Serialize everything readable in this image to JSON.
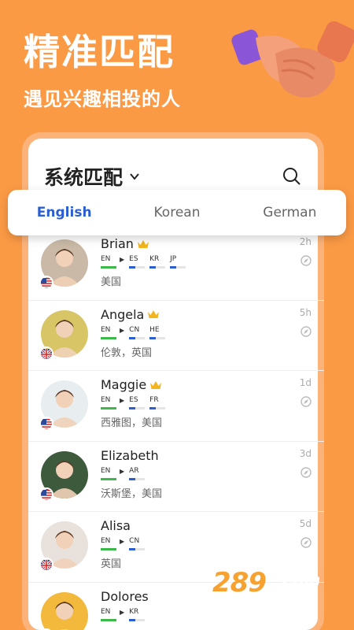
{
  "hero": {
    "title": "精准匹配",
    "subtitle": "遇见兴趣相投的人"
  },
  "card": {
    "title": "系统匹配",
    "search_icon": "search-icon",
    "chevron_icon": "chevron-down-icon"
  },
  "tabs": [
    {
      "label": "English",
      "active": true
    },
    {
      "label": "Korean",
      "active": false
    },
    {
      "label": "German",
      "active": false
    }
  ],
  "users": [
    {
      "name": "Brian",
      "crown": true,
      "langs": [
        "EN",
        "ES",
        "KR",
        "JP"
      ],
      "location": "美国",
      "time": "2h",
      "flag": "us",
      "avatar_color": "#c9b9a6"
    },
    {
      "name": "Angela",
      "crown": true,
      "langs": [
        "EN",
        "CN",
        "HE"
      ],
      "location": "伦敦，英国",
      "time": "5h",
      "flag": "uk",
      "avatar_color": "#d8c566"
    },
    {
      "name": "Maggie",
      "crown": true,
      "langs": [
        "EN",
        "ES",
        "FR"
      ],
      "location": "西雅图，美国",
      "time": "1d",
      "flag": "us",
      "avatar_color": "#e8eef0"
    },
    {
      "name": "Elizabeth",
      "crown": false,
      "langs": [
        "EN",
        "AR"
      ],
      "location": "沃斯堡，美国",
      "time": "3d",
      "flag": "us",
      "avatar_color": "#3e5a3c"
    },
    {
      "name": "Alisa",
      "crown": false,
      "langs": [
        "EN",
        "CN"
      ],
      "location": "英国",
      "time": "5d",
      "flag": "uk",
      "avatar_color": "#e9e2dc"
    },
    {
      "name": "Dolores",
      "crown": false,
      "langs": [
        "EN",
        "KR"
      ],
      "location": "",
      "time": "",
      "flag": "us",
      "avatar_color": "#f3b93c"
    }
  ],
  "watermark": {
    "main": "289",
    "com": "Com",
    "sub": "手游网"
  },
  "colors": {
    "background": "#fb9a45",
    "accent_blue": "#2b5fd0",
    "native_green": "#3cb94a",
    "learning_blue": "#2b5fd0",
    "crown_gold": "#f2b51d"
  }
}
